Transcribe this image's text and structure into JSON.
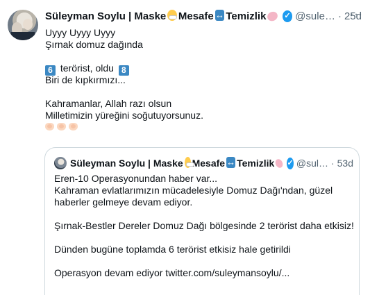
{
  "tweet": {
    "author": {
      "name": "Süleyman Soylu | Maske",
      "name_part_2": " Mesafe",
      "name_part_3": " Temizlik",
      "handle": "@sule…",
      "separator": "·",
      "time": "25d"
    },
    "more_label": "···",
    "text": {
      "line1": "Uyyy Uyyy Uyyy",
      "line2": "Şırnak domuz dağında",
      "num1": "6",
      "line3_mid": " terörist, oldu ",
      "num2": "8",
      "line4": "Biri de kıpkırmızı...",
      "line5": "Kahramanlar, Allah razı olsun",
      "line6": "Milletimizin yüreğini soğutuyorsunuz."
    },
    "emoji_icons": [
      "face-with-medical-mask",
      "left-right-arrow",
      "soap",
      "clapping-hands"
    ],
    "colors": {
      "verified": "#1d9bf0",
      "secondary_text": "#536471",
      "border": "#cfd9de",
      "keycap": "#3b88c3"
    }
  },
  "quoted_tweet": {
    "author": {
      "name": "Süleyman Soylu | Maske",
      "name_part_2": " Mesafe",
      "name_part_3": " Temizlik",
      "handle": "@sul…",
      "separator": "·",
      "time": "53d"
    },
    "text": {
      "line1": "Eren-10 Operasyonundan haber var...",
      "line2": "Kahraman evlatlarımızın mücadelesiyle Domuz Dağı'ndan, güzel",
      "line3": "haberler gelmeye devam ediyor.",
      "line4": "Şırnak-Bestler Dereler Domuz Dağı bölgesinde 2 terörist daha etkisiz!",
      "line5": "Dünden bugüne toplamda 6 terörist etkisiz hale getirildi",
      "line6": "Operasyon devam ediyor twitter.com/suleymansoylu/..."
    }
  }
}
